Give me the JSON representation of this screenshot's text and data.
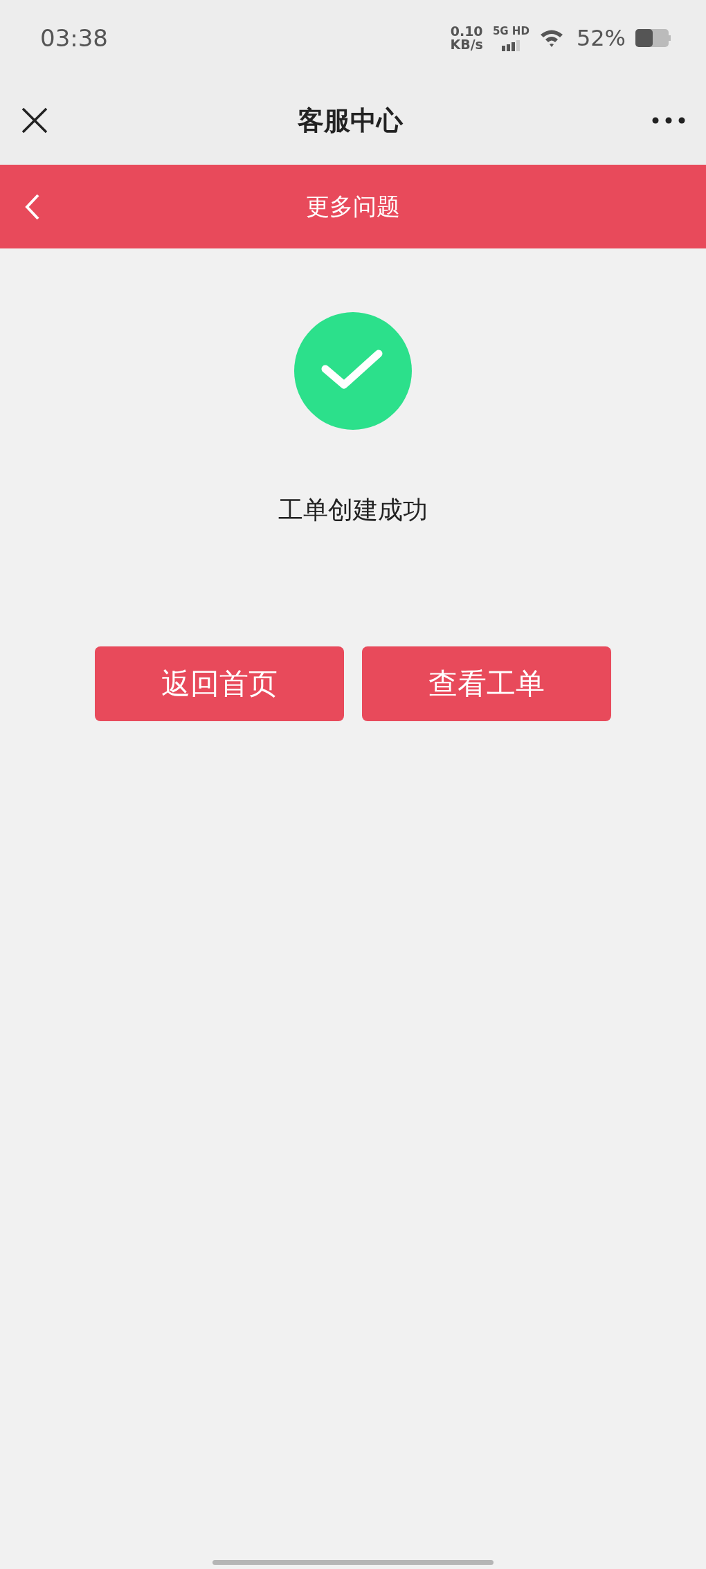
{
  "status_bar": {
    "time": "03:38",
    "speed": "0.10",
    "speed_unit": "KB/s",
    "network": "5G HD",
    "battery": "52%"
  },
  "nav": {
    "title": "客服中心"
  },
  "header": {
    "title": "更多问题"
  },
  "result": {
    "message": "工单创建成功"
  },
  "buttons": [
    {
      "label": "返回首页"
    },
    {
      "label": "查看工单"
    }
  ]
}
